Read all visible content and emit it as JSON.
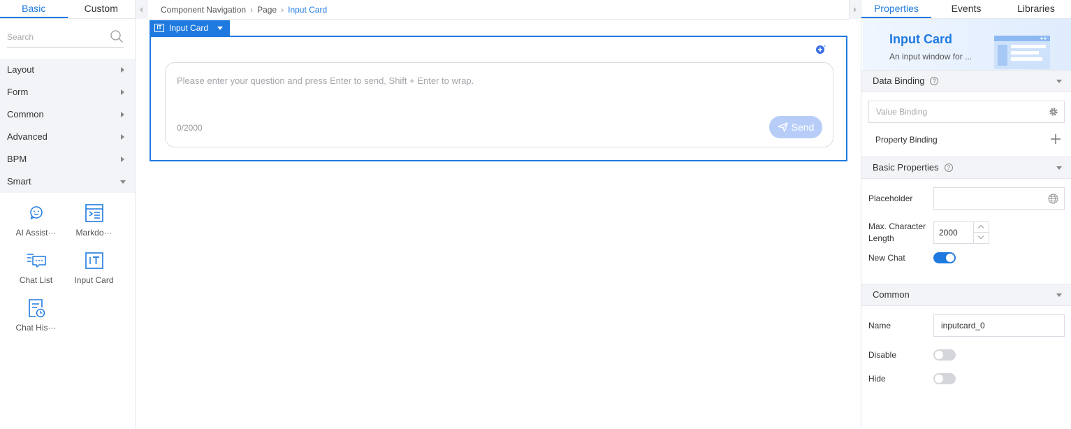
{
  "left_panel": {
    "tabs": [
      {
        "label": "Basic"
      },
      {
        "label": "Custom"
      }
    ],
    "search_placeholder": "Search",
    "categories": [
      {
        "label": "Layout",
        "expanded": false
      },
      {
        "label": "Form",
        "expanded": false
      },
      {
        "label": "Common",
        "expanded": false
      },
      {
        "label": "Advanced",
        "expanded": false
      },
      {
        "label": "BPM",
        "expanded": false
      },
      {
        "label": "Smart",
        "expanded": true
      }
    ],
    "components": [
      {
        "label": "AI Assist···",
        "icon": "ai-assistant-icon"
      },
      {
        "label": "Markdo···",
        "icon": "markdown-icon"
      },
      {
        "label": "Chat List",
        "icon": "chat-list-icon"
      },
      {
        "label": "Input Card",
        "icon": "input-card-icon"
      },
      {
        "label": "Chat His···",
        "icon": "chat-history-icon"
      }
    ]
  },
  "center": {
    "breadcrumb": [
      "Component Navigation",
      "Page",
      "Input Card"
    ],
    "selected_tag": "Input Card",
    "input_card": {
      "placeholder": "Please enter your question and press Enter to send, Shift + Enter to wrap.",
      "counter": "0/2000",
      "send_label": "Send"
    }
  },
  "right_panel": {
    "tabs": [
      {
        "label": "Properties"
      },
      {
        "label": "Events"
      },
      {
        "label": "Libraries"
      }
    ],
    "banner": {
      "title": "Input Card",
      "description": "An input window for ..."
    },
    "data_binding": {
      "title": "Data Binding",
      "value_binding_placeholder": "Value Binding",
      "property_binding_label": "Property Binding"
    },
    "basic_properties": {
      "title": "Basic Properties",
      "placeholder_label": "Placeholder",
      "placeholder_value": "",
      "max_length_label": "Max. Character Length",
      "max_length_value": "2000",
      "new_chat_label": "New Chat",
      "new_chat_on": true
    },
    "common": {
      "title": "Common",
      "name_label": "Name",
      "name_value": "inputcard_0",
      "disable_label": "Disable",
      "disable_on": false,
      "hide_label": "Hide",
      "hide_on": false
    }
  },
  "colors": {
    "accent": "#1f7ae0",
    "send_disabled": "#b7cdf8",
    "panel_bg": "#f3f4f7"
  }
}
